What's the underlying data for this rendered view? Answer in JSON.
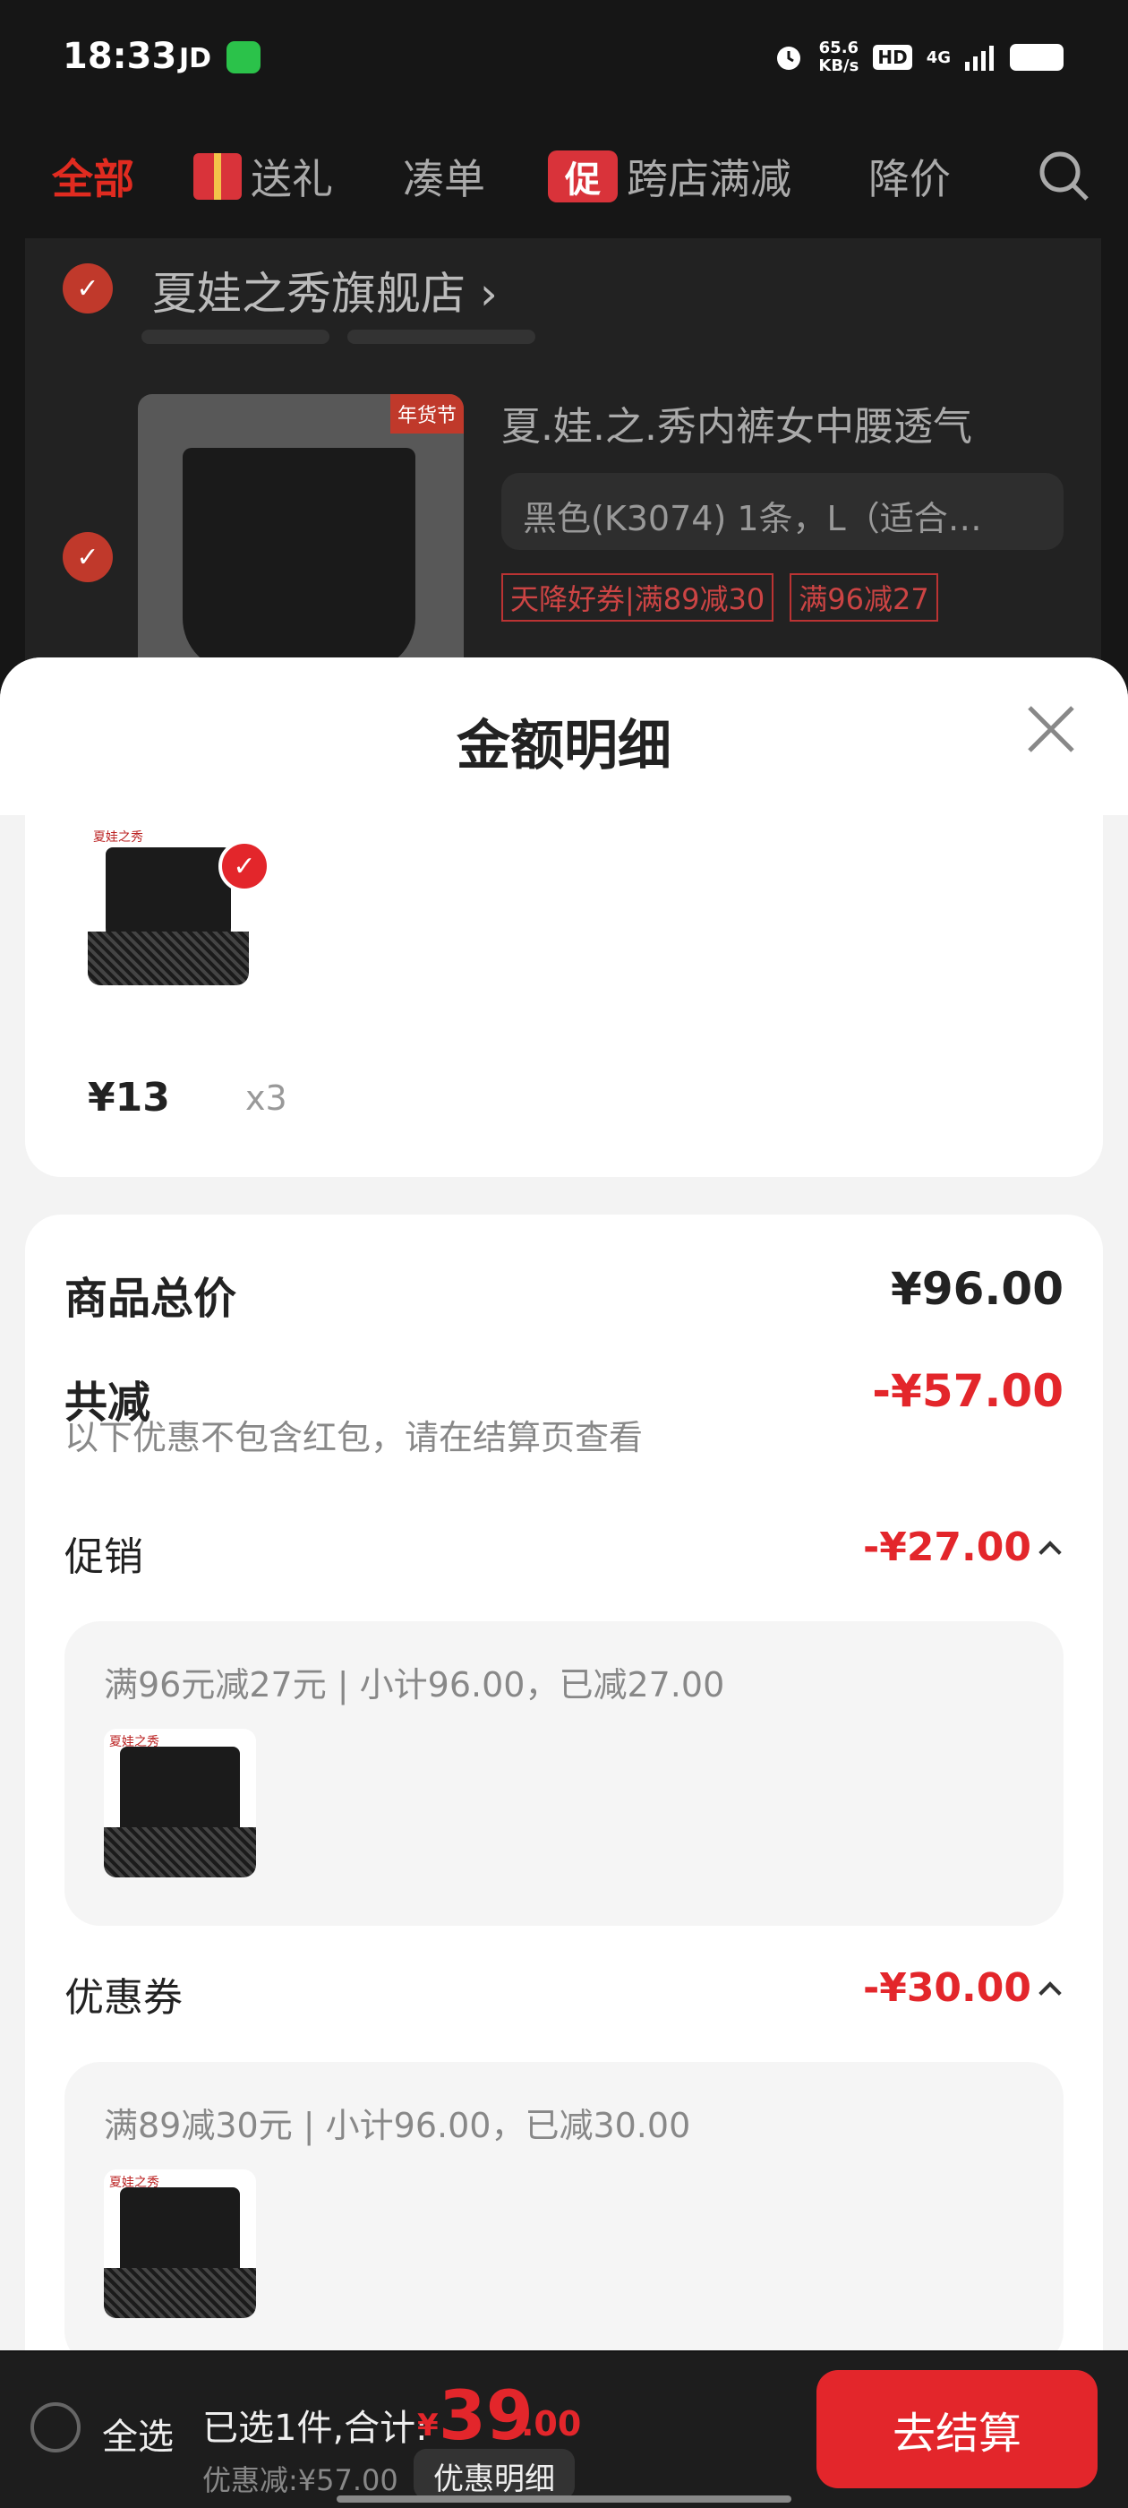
{
  "status_bar": {
    "time": "18:33",
    "carrier_tag": "JD",
    "net_speed_top": "65.6",
    "net_speed_unit": "KB/s",
    "hd": "HD",
    "signal": "4G"
  },
  "tabs": {
    "all": "全部",
    "gift": "送礼",
    "bundle": "凑单",
    "promo_badge": "促",
    "cross_store": "跨店满减",
    "price_drop": "降价"
  },
  "store": {
    "name": "夏娃之秀旗舰店",
    "product_title": "夏.娃.之.秀内裤女中腰透气",
    "product_tag": "年货节",
    "spec": "黑色(K3074) 1条，L（适合…",
    "promo_tags": [
      "天降好券|满89减30",
      "满96减27"
    ]
  },
  "sheet": {
    "title": "金额明细",
    "unit_price": "¥13",
    "quantity": "x3",
    "goods_total_label": "商品总价",
    "goods_total_value": "¥96.00",
    "reduce_label": "共减",
    "reduce_value": "-¥57.00",
    "reduce_note": "以下优惠不包含红包，请在结算页查看",
    "promo_label": "促销",
    "promo_value": "-¥27.00",
    "promo_desc": "满96元减27元 | 小计96.00，已减27.00",
    "coupon_label": "优惠券",
    "coupon_value": "-¥30.00",
    "coupon_desc": "满89减30元 | 小计96.00，已减30.00",
    "brand_mark": "夏娃之秀"
  },
  "bottom_bar": {
    "select_all": "全选",
    "selected_summary": "已选1件,合计:",
    "currency": "¥",
    "total_integer": "39",
    "total_decimal": ".00",
    "discount_text": "优惠减:¥57.00",
    "detail_link": "优惠明细",
    "checkout": "去结算"
  },
  "colors": {
    "accent_red": "#e3262b",
    "dark_bg": "#161616"
  }
}
